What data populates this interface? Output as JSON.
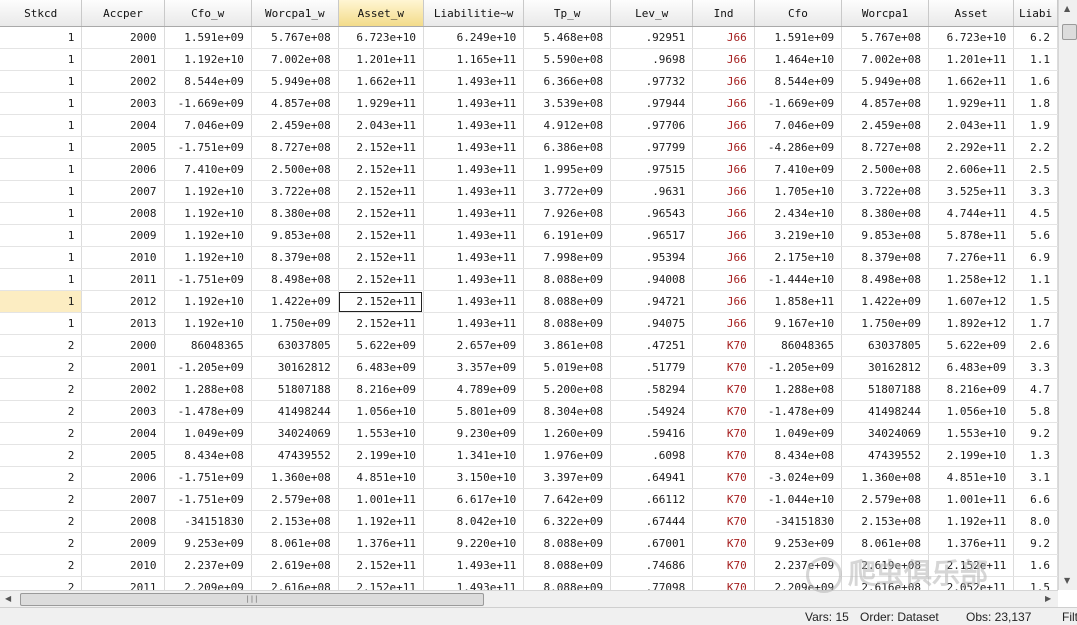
{
  "columns": [
    {
      "label": "Stkcd",
      "width": 88
    },
    {
      "label": "Accper",
      "width": 86
    },
    {
      "label": "Cfo_w",
      "width": 85
    },
    {
      "label": "Worcpa1_w",
      "width": 86
    },
    {
      "label": "Asset_w",
      "width": 84
    },
    {
      "label": "Liabilitie~w",
      "width": 99
    },
    {
      "label": "Tp_w",
      "width": 86
    },
    {
      "label": "Lev_w",
      "width": 85
    },
    {
      "label": "Ind",
      "width": 64
    },
    {
      "label": "Cfo",
      "width": 85
    },
    {
      "label": "Worcpa1",
      "width": 86
    },
    {
      "label": "Asset",
      "width": 84
    },
    {
      "label": "Liabi",
      "width": 40
    }
  ],
  "selected_column": 4,
  "current_cell": {
    "row": 12,
    "col": 4
  },
  "rows": [
    [
      "1",
      "2000",
      "1.591e+09",
      "5.767e+08",
      "6.723e+10",
      "6.249e+10",
      "5.468e+08",
      ".92951",
      "J66",
      "1.591e+09",
      "5.767e+08",
      "6.723e+10",
      "6.2"
    ],
    [
      "1",
      "2001",
      "1.192e+10",
      "7.002e+08",
      "1.201e+11",
      "1.165e+11",
      "5.590e+08",
      ".9698",
      "J66",
      "1.464e+10",
      "7.002e+08",
      "1.201e+11",
      "1.1"
    ],
    [
      "1",
      "2002",
      "8.544e+09",
      "5.949e+08",
      "1.662e+11",
      "1.493e+11",
      "6.366e+08",
      ".97732",
      "J66",
      "8.544e+09",
      "5.949e+08",
      "1.662e+11",
      "1.6"
    ],
    [
      "1",
      "2003",
      "-1.669e+09",
      "4.857e+08",
      "1.929e+11",
      "1.493e+11",
      "3.539e+08",
      ".97944",
      "J66",
      "-1.669e+09",
      "4.857e+08",
      "1.929e+11",
      "1.8"
    ],
    [
      "1",
      "2004",
      "7.046e+09",
      "2.459e+08",
      "2.043e+11",
      "1.493e+11",
      "4.912e+08",
      ".97706",
      "J66",
      "7.046e+09",
      "2.459e+08",
      "2.043e+11",
      "1.9"
    ],
    [
      "1",
      "2005",
      "-1.751e+09",
      "8.727e+08",
      "2.152e+11",
      "1.493e+11",
      "6.386e+08",
      ".97799",
      "J66",
      "-4.286e+09",
      "8.727e+08",
      "2.292e+11",
      "2.2"
    ],
    [
      "1",
      "2006",
      "7.410e+09",
      "2.500e+08",
      "2.152e+11",
      "1.493e+11",
      "1.995e+09",
      ".97515",
      "J66",
      "7.410e+09",
      "2.500e+08",
      "2.606e+11",
      "2.5"
    ],
    [
      "1",
      "2007",
      "1.192e+10",
      "3.722e+08",
      "2.152e+11",
      "1.493e+11",
      "3.772e+09",
      ".9631",
      "J66",
      "1.705e+10",
      "3.722e+08",
      "3.525e+11",
      "3.3"
    ],
    [
      "1",
      "2008",
      "1.192e+10",
      "8.380e+08",
      "2.152e+11",
      "1.493e+11",
      "7.926e+08",
      ".96543",
      "J66",
      "2.434e+10",
      "8.380e+08",
      "4.744e+11",
      "4.5"
    ],
    [
      "1",
      "2009",
      "1.192e+10",
      "9.853e+08",
      "2.152e+11",
      "1.493e+11",
      "6.191e+09",
      ".96517",
      "J66",
      "3.219e+10",
      "9.853e+08",
      "5.878e+11",
      "5.6"
    ],
    [
      "1",
      "2010",
      "1.192e+10",
      "8.379e+08",
      "2.152e+11",
      "1.493e+11",
      "7.998e+09",
      ".95394",
      "J66",
      "2.175e+10",
      "8.379e+08",
      "7.276e+11",
      "6.9"
    ],
    [
      "1",
      "2011",
      "-1.751e+09",
      "8.498e+08",
      "2.152e+11",
      "1.493e+11",
      "8.088e+09",
      ".94008",
      "J66",
      "-1.444e+10",
      "8.498e+08",
      "1.258e+12",
      "1.1"
    ],
    [
      "1",
      "2012",
      "1.192e+10",
      "1.422e+09",
      "2.152e+11",
      "1.493e+11",
      "8.088e+09",
      ".94721",
      "J66",
      "1.858e+11",
      "1.422e+09",
      "1.607e+12",
      "1.5"
    ],
    [
      "1",
      "2013",
      "1.192e+10",
      "1.750e+09",
      "2.152e+11",
      "1.493e+11",
      "8.088e+09",
      ".94075",
      "J66",
      "9.167e+10",
      "1.750e+09",
      "1.892e+12",
      "1.7"
    ],
    [
      "2",
      "2000",
      "86048365",
      "63037805",
      "5.622e+09",
      "2.657e+09",
      "3.861e+08",
      ".47251",
      "K70",
      "86048365",
      "63037805",
      "5.622e+09",
      "2.6"
    ],
    [
      "2",
      "2001",
      "-1.205e+09",
      "30162812",
      "6.483e+09",
      "3.357e+09",
      "5.019e+08",
      ".51779",
      "K70",
      "-1.205e+09",
      "30162812",
      "6.483e+09",
      "3.3"
    ],
    [
      "2",
      "2002",
      "1.288e+08",
      "51807188",
      "8.216e+09",
      "4.789e+09",
      "5.200e+08",
      ".58294",
      "K70",
      "1.288e+08",
      "51807188",
      "8.216e+09",
      "4.7"
    ],
    [
      "2",
      "2003",
      "-1.478e+09",
      "41498244",
      "1.056e+10",
      "5.801e+09",
      "8.304e+08",
      ".54924",
      "K70",
      "-1.478e+09",
      "41498244",
      "1.056e+10",
      "5.8"
    ],
    [
      "2",
      "2004",
      "1.049e+09",
      "34024069",
      "1.553e+10",
      "9.230e+09",
      "1.260e+09",
      ".59416",
      "K70",
      "1.049e+09",
      "34024069",
      "1.553e+10",
      "9.2"
    ],
    [
      "2",
      "2005",
      "8.434e+08",
      "47439552",
      "2.199e+10",
      "1.341e+10",
      "1.976e+09",
      ".6098",
      "K70",
      "8.434e+08",
      "47439552",
      "2.199e+10",
      "1.3"
    ],
    [
      "2",
      "2006",
      "-1.751e+09",
      "1.360e+08",
      "4.851e+10",
      "3.150e+10",
      "3.397e+09",
      ".64941",
      "K70",
      "-3.024e+09",
      "1.360e+08",
      "4.851e+10",
      "3.1"
    ],
    [
      "2",
      "2007",
      "-1.751e+09",
      "2.579e+08",
      "1.001e+11",
      "6.617e+10",
      "7.642e+09",
      ".66112",
      "K70",
      "-1.044e+10",
      "2.579e+08",
      "1.001e+11",
      "6.6"
    ],
    [
      "2",
      "2008",
      "-34151830",
      "2.153e+08",
      "1.192e+11",
      "8.042e+10",
      "6.322e+09",
      ".67444",
      "K70",
      "-34151830",
      "2.153e+08",
      "1.192e+11",
      "8.0"
    ],
    [
      "2",
      "2009",
      "9.253e+09",
      "8.061e+08",
      "1.376e+11",
      "9.220e+10",
      "8.088e+09",
      ".67001",
      "K70",
      "9.253e+09",
      "8.061e+08",
      "1.376e+11",
      "9.2"
    ],
    [
      "2",
      "2010",
      "2.237e+09",
      "2.619e+08",
      "2.152e+11",
      "1.493e+11",
      "8.088e+09",
      ".74686",
      "K70",
      "2.237e+09",
      "2.619e+08",
      "2.152e+11",
      "1.6"
    ],
    [
      "2",
      "2011",
      "2.209e+09",
      "2.616e+08",
      "2.152e+11",
      "1.493e+11",
      "8.088e+09",
      ".77098",
      "K70",
      "2.209e+09",
      "2.616e+08",
      "2.052e+11",
      "1.5"
    ]
  ],
  "status": {
    "vars": "Vars: 15",
    "order": "Order: Dataset",
    "obs": "Obs: 23,137",
    "filter": "Filt"
  },
  "watermark": {
    "text": "爬虫俱乐部"
  }
}
